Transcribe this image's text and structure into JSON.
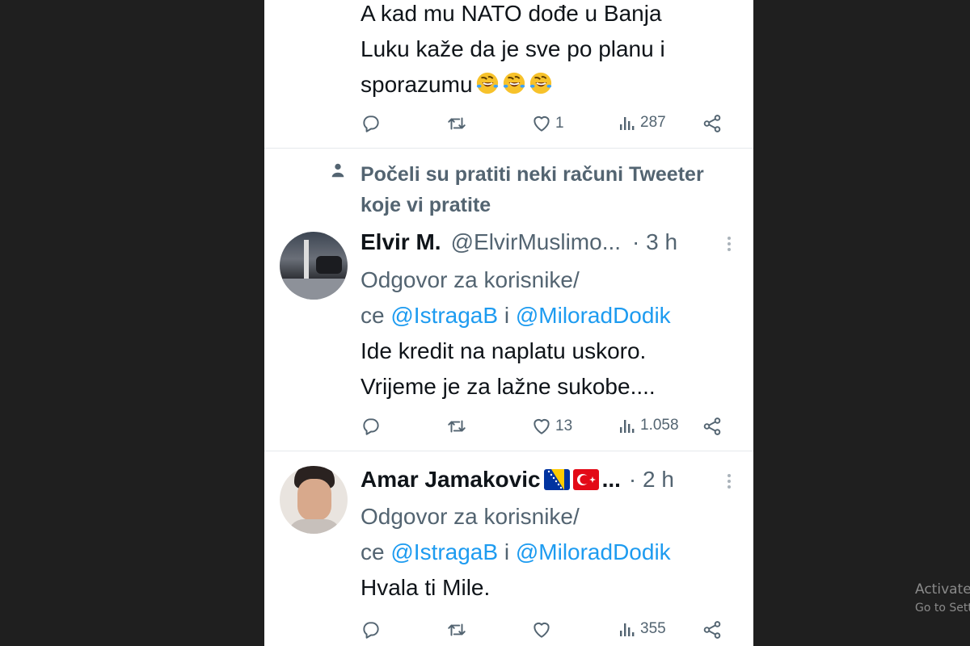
{
  "tweet1": {
    "text_lines": [
      "A kad mu NATO dođe u Banja",
      "Luku kaže da je sve po planu i",
      "sporazumu"
    ],
    "emoji": [
      "rofl-emoji",
      "rofl-emoji",
      "rofl-emoji"
    ],
    "likes": "1",
    "views": "287"
  },
  "social_context": {
    "icon": "person-icon",
    "lines": [
      "Počeli su pratiti neki računi Tweeter",
      "koje vi pratite"
    ]
  },
  "tweet2": {
    "name": "Elvir M.",
    "handle": "@ElvirMuslimo...",
    "time": "· 3 h",
    "reply_line1": "Odgovor za korisnike/",
    "reply_prefix": "ce ",
    "mention1": "@IstragaB",
    "conj": " i ",
    "mention2": "@MiloradDodik",
    "text_lines": [
      "Ide kredit na naplatu uskoro.",
      "Vrijeme je za lažne sukobe...."
    ],
    "likes": "13",
    "views": "1.058"
  },
  "tweet3": {
    "name": "Amar Jamakovic",
    "flags": [
      "bosnia-flag",
      "turkey-flag"
    ],
    "name_suffix": "...",
    "time": "· 2 h",
    "reply_line1": "Odgovor za korisnike/",
    "reply_prefix": "ce ",
    "mention1": "@IstragaB",
    "conj": " i ",
    "mention2": "@MiloradDodik",
    "text": "Hvala ti Mile.",
    "views": "355"
  },
  "watermark": {
    "line1": "Activate",
    "line2": "Go to Sett"
  },
  "colors": {
    "link": "#1d9bf0",
    "muted": "#536471",
    "background": "#1f1f1f"
  }
}
